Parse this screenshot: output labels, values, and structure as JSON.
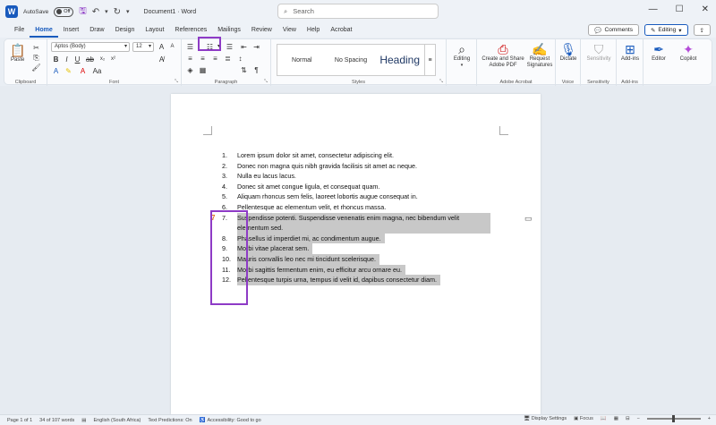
{
  "titlebar": {
    "autosave_label": "AutoSave",
    "toggle_state": "Off",
    "doc_title": "Document1 · Word",
    "search_placeholder": "Search",
    "minimize": "—",
    "maximize": "☐",
    "close": "✕"
  },
  "menu": {
    "items": [
      "File",
      "Home",
      "Insert",
      "Draw",
      "Design",
      "Layout",
      "References",
      "Mailings",
      "Review",
      "View",
      "Help",
      "Acrobat"
    ],
    "active": "Home",
    "comments_label": "Comments",
    "editing_label": "Editing",
    "share_icon": "share-icon"
  },
  "ribbon": {
    "clipboard": {
      "paste_label": "Paste",
      "group_label": "Clipboard"
    },
    "font": {
      "font_name": "Aptos (Body)",
      "font_size": "12",
      "group_label": "Font"
    },
    "paragraph": {
      "group_label": "Paragraph"
    },
    "styles": {
      "items": [
        "Normal",
        "No Spacing",
        "Heading"
      ],
      "group_label": "Styles"
    },
    "editing": {
      "label": "Editing"
    },
    "acrobat": {
      "create_share_label": "Create and Share Adobe PDF",
      "request_sig_label": "Request Signatures",
      "group_label": "Adobe Acrobat"
    },
    "voice": {
      "dictate_label": "Dictate",
      "group_label": "Voice"
    },
    "sensitivity": {
      "label": "Sensitivity",
      "group_label": "Sensitivity"
    },
    "addins": {
      "label": "Add-ins",
      "group_label": "Add-ins"
    },
    "editor_label": "Editor",
    "copilot_label": "Copilot"
  },
  "document": {
    "list": [
      {
        "num": "1.",
        "text": "Lorem ipsum dolor sit amet, consectetur adipiscing elit.",
        "selected": false
      },
      {
        "num": "2.",
        "text": "Donec non magna quis nibh gravida facilisis sit amet ac neque.",
        "selected": false
      },
      {
        "num": "3.",
        "text": "Nulla eu lacus lacus.",
        "selected": false
      },
      {
        "num": "4.",
        "text": "Donec sit amet congue ligula, et consequat quam.",
        "selected": false
      },
      {
        "num": "5.",
        "text": "Aliquam rhoncus sem felis, laoreet lobortis augue consequat in.",
        "selected": false
      },
      {
        "num": "6.",
        "text": "Pellentesque ac elementum velit, et rhoncus massa.",
        "selected": false
      },
      {
        "num": "7.",
        "text": "Suspendisse potenti. Suspendisse venenatis enim magna, nec bibendum velit elementum sed.",
        "selected": true
      },
      {
        "num": "8.",
        "text": "Phasellus id imperdiet mi, ac condimentum augue.",
        "selected": true
      },
      {
        "num": "9.",
        "text": "Morbi vitae placerat sem.",
        "selected": true
      },
      {
        "num": "10.",
        "text": "Mauris convallis leo nec mi tincidunt scelerisque.",
        "selected": true
      },
      {
        "num": "11.",
        "text": "Morbi sagittis fermentum enim, eu efficitur arcu ornare eu.",
        "selected": true
      },
      {
        "num": "12.",
        "text": "Pellentesque turpis urna, tempus id velit id, dapibus consectetur diam.",
        "selected": true
      }
    ],
    "marker_7": "7"
  },
  "status": {
    "page": "Page 1 of 1",
    "words": "34 of 107 words",
    "language": "English (South Africa)",
    "predictions": "Text Predictions: On",
    "accessibility": "Accessibility: Good to go",
    "display_settings": "Display Settings",
    "focus": "Focus"
  },
  "colors": {
    "accent": "#185abd",
    "highlight": "#8e3bc6",
    "selection": "#c8c8c8"
  }
}
